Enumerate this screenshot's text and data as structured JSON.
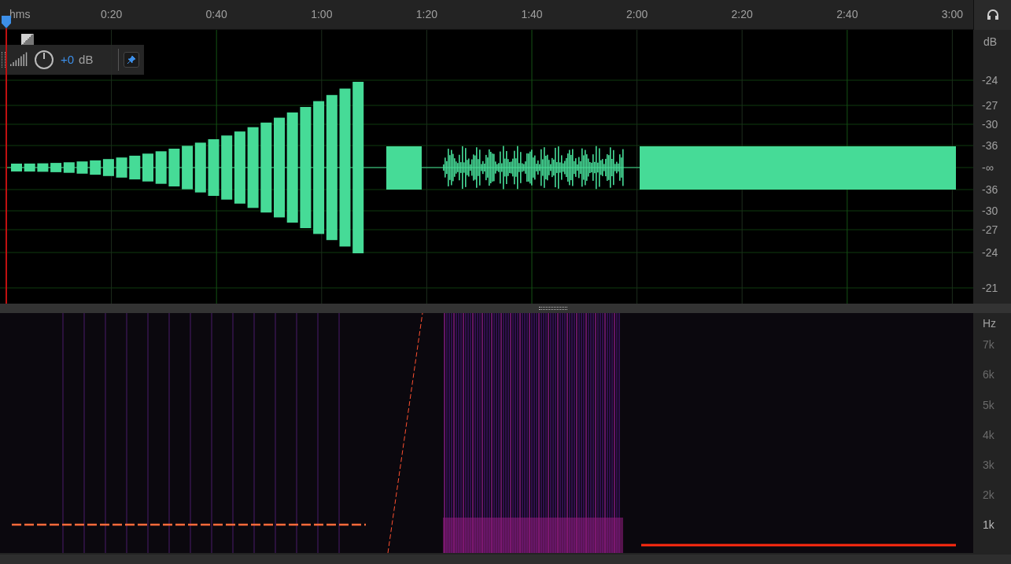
{
  "ruler": {
    "unit": "hms",
    "ticks": [
      "0:20",
      "0:40",
      "1:00",
      "1:20",
      "1:40",
      "2:00",
      "2:20",
      "2:40",
      "3:00"
    ]
  },
  "waveform": {
    "gain_overlay": {
      "value": "+0",
      "unit": "dB"
    },
    "scale": {
      "unit": "dB",
      "labels": [
        "-24",
        "-27",
        "-30",
        "-36",
        "-∞",
        "-36",
        "-30",
        "-27",
        "-24",
        "-21"
      ]
    }
  },
  "spectral": {
    "scale": {
      "unit": "Hz",
      "labels": [
        "7k",
        "6k",
        "5k",
        "4k",
        "3k",
        "2k",
        "1k"
      ]
    }
  }
}
